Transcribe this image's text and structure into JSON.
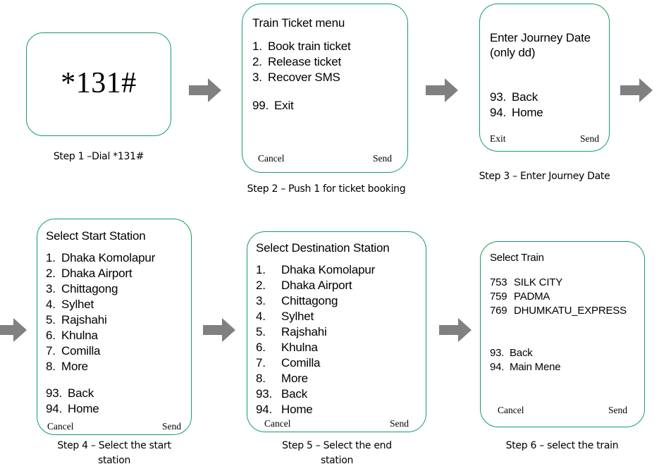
{
  "diagram": {
    "title_hidden": "USSD Train Ticket Booking Flow",
    "accent_color": "#12a05c",
    "arrow_color": "#808080",
    "background_color": "#ffffff"
  },
  "steps": [
    {
      "id": "step-1",
      "screen": {
        "dial_code": "*131#"
      },
      "caption": "Step 1 –Dial *131#"
    },
    {
      "id": "step-2",
      "screen": {
        "title": "Train Ticket menu",
        "items": [
          {
            "num": "1.",
            "label": "Book train ticket"
          },
          {
            "num": "2.",
            "label": "Release ticket"
          },
          {
            "num": "3.",
            "label": "Recover SMS"
          }
        ],
        "items2": [
          {
            "num": "99.",
            "label": "Exit"
          }
        ],
        "softkey_left": "Cancel",
        "softkey_right": "Send"
      },
      "caption": "Step 2 – Push 1 for ticket booking"
    },
    {
      "id": "step-3",
      "screen": {
        "title_line1": "Enter Journey Date",
        "title_line2": "(only dd)",
        "items": [
          {
            "num": "93.",
            "label": "Back"
          },
          {
            "num": "94.",
            "label": "Home"
          }
        ],
        "softkey_left": "Exit",
        "softkey_right": "Send"
      },
      "caption": "Step 3 – Enter Journey Date"
    },
    {
      "id": "step-4",
      "screen": {
        "title": "Select Start Station",
        "items": [
          {
            "num": "1.",
            "label": "Dhaka Komolapur"
          },
          {
            "num": "2.",
            "label": "Dhaka Airport"
          },
          {
            "num": "3.",
            "label": "Chittagong"
          },
          {
            "num": "4.",
            "label": "Sylhet"
          },
          {
            "num": "5.",
            "label": "Rajshahi"
          },
          {
            "num": "6.",
            "label": "Khulna"
          },
          {
            "num": "7.",
            "label": "Comilla"
          },
          {
            "num": "8.",
            "label": "More"
          }
        ],
        "items2": [
          {
            "num": "93.",
            "label": "Back"
          },
          {
            "num": "94.",
            "label": "Home"
          }
        ],
        "softkey_left": "Cancel",
        "softkey_right": "Send"
      },
      "caption": "Step 4 – Select the start\nstation"
    },
    {
      "id": "step-5",
      "screen": {
        "title": "Select Destination Station",
        "items": [
          {
            "num": "1.",
            "label": "Dhaka Komolapur"
          },
          {
            "num": "2.",
            "label": "Dhaka Airport"
          },
          {
            "num": "3.",
            "label": "Chittagong"
          },
          {
            "num": "4.",
            "label": "Sylhet"
          },
          {
            "num": "5.",
            "label": "Rajshahi"
          },
          {
            "num": "6.",
            "label": "Khulna"
          },
          {
            "num": "7.",
            "label": "Comilla"
          },
          {
            "num": "8.",
            "label": "More"
          },
          {
            "num": "93.",
            "label": "Back"
          },
          {
            "num": "94.",
            "label": "Home"
          }
        ],
        "softkey_left": "Cancel",
        "softkey_right": "Send"
      },
      "caption": "Step 5 – Select the end\nstation"
    },
    {
      "id": "step-6",
      "screen": {
        "title": "Select Train",
        "items": [
          {
            "num": "753",
            "label": "SILK CITY"
          },
          {
            "num": "759",
            "label": "PADMA"
          },
          {
            "num": "769",
            "label": "DHUMKATU_EXPRESS"
          }
        ],
        "items2": [
          {
            "num": "93.",
            "label": "Back"
          },
          {
            "num": "94.",
            "label": "Main Mene"
          }
        ],
        "softkey_left": "Cancel",
        "softkey_right": "Send"
      },
      "caption": "Step 6 – select the train"
    }
  ],
  "arrows": [
    {
      "id": "arrow-1-2",
      "name": "flow-arrow-right"
    },
    {
      "id": "arrow-2-3",
      "name": "flow-arrow-right"
    },
    {
      "id": "arrow-3-next",
      "name": "flow-arrow-right"
    },
    {
      "id": "arrow-prev-4",
      "name": "flow-arrow-right"
    },
    {
      "id": "arrow-4-5",
      "name": "flow-arrow-right"
    },
    {
      "id": "arrow-5-6",
      "name": "flow-arrow-right"
    }
  ]
}
